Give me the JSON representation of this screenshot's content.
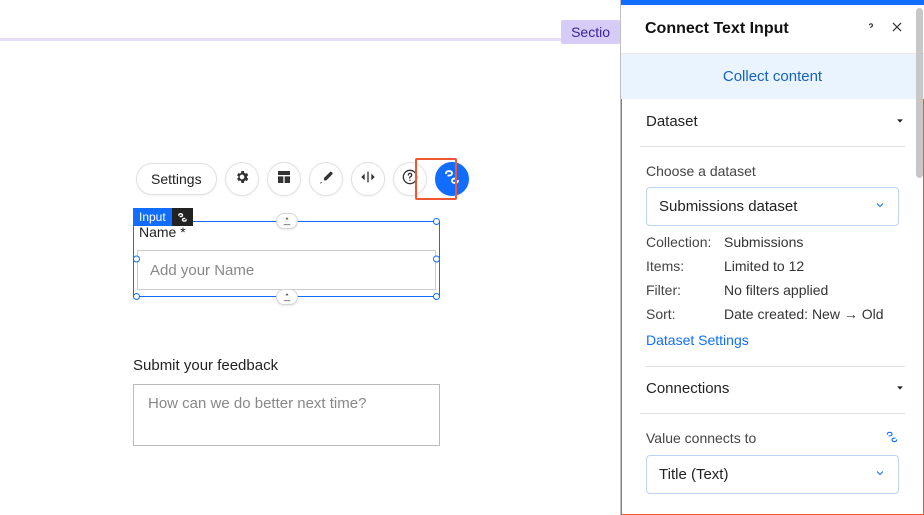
{
  "canvas": {
    "topTag": "Sectio",
    "toolbar": {
      "settings": "Settings"
    },
    "elementBadge": {
      "label": "Input"
    },
    "nameField": {
      "label": "Name *",
      "placeholder": "Add your Name"
    },
    "feedback": {
      "label": "Submit your feedback",
      "placeholder": "How can we do better next time?"
    }
  },
  "panel": {
    "title": "Connect Text Input",
    "collectBanner": "Collect content",
    "sections": {
      "dataset": {
        "header": "Dataset",
        "chooseLabel": "Choose a dataset",
        "selected": "Submissions dataset",
        "collectionKey": "Collection:",
        "collectionVal": "Submissions",
        "itemsKey": "Items:",
        "itemsVal": "Limited to 12",
        "filterKey": "Filter:",
        "filterVal": "No filters applied",
        "sortKey": "Sort:",
        "sortVal": "Date created: New → Old",
        "settingsLink": "Dataset Settings"
      },
      "connections": {
        "header": "Connections",
        "valueLabel": "Value connects to",
        "selected": "Title (Text)"
      }
    }
  }
}
